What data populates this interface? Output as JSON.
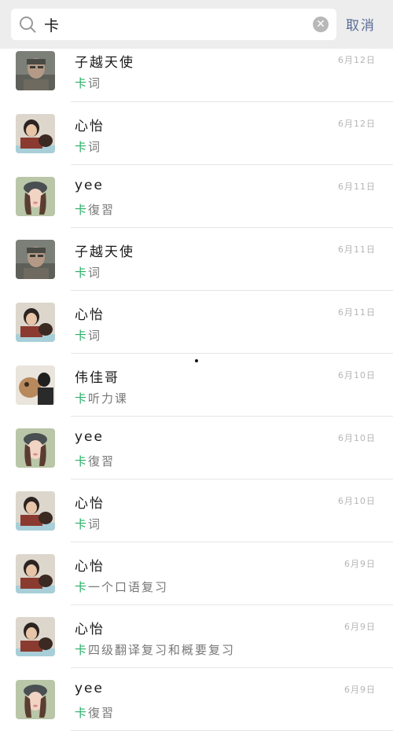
{
  "search": {
    "query": "卡",
    "cancel_label": "取消"
  },
  "results": [
    {
      "name": "子越天使",
      "highlight": "卡",
      "snippet": "词",
      "date": "6月12日",
      "avatar": "man-gray"
    },
    {
      "name": "心怡",
      "highlight": "卡",
      "snippet": "词",
      "date": "6月12日",
      "avatar": "girl-dog"
    },
    {
      "name": "yee",
      "highlight": "卡",
      "snippet": "復習",
      "date": "6月11日",
      "avatar": "girl-hat"
    },
    {
      "name": "子越天使",
      "highlight": "卡",
      "snippet": "词",
      "date": "6月11日",
      "avatar": "man-gray"
    },
    {
      "name": "心怡",
      "highlight": "卡",
      "snippet": "词",
      "date": "6月11日",
      "avatar": "girl-dog"
    },
    {
      "name": "伟佳哥",
      "highlight": "卡",
      "snippet": "听力课",
      "date": "6月10日",
      "avatar": "dog-man"
    },
    {
      "name": "yee",
      "highlight": "卡",
      "snippet": "復習",
      "date": "6月10日",
      "avatar": "girl-hat"
    },
    {
      "name": "心怡",
      "highlight": "卡",
      "snippet": "词",
      "date": "6月10日",
      "avatar": "girl-dog"
    },
    {
      "name": "心怡",
      "highlight": "卡",
      "snippet": "一个口语复习",
      "date": "6月9日",
      "avatar": "girl-dog"
    },
    {
      "name": "心怡",
      "highlight": "卡",
      "snippet": "四级翻译复习和概要复习",
      "date": "6月9日",
      "avatar": "girl-dog"
    },
    {
      "name": "yee",
      "highlight": "卡",
      "snippet": "復習",
      "date": "6月9日",
      "avatar": "girl-hat"
    }
  ]
}
